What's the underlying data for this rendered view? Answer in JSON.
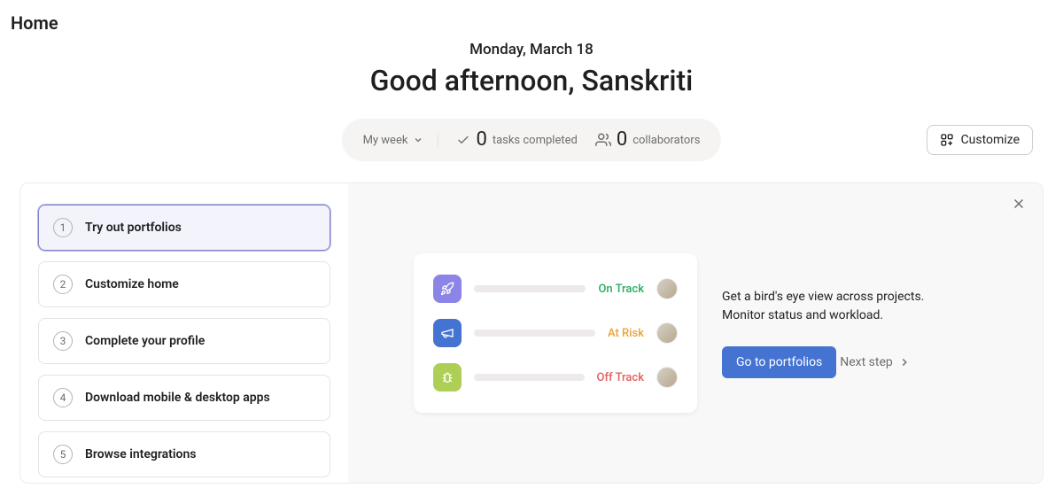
{
  "header": {
    "title": "Home"
  },
  "hero": {
    "date": "Monday, March 18",
    "greeting": "Good afternoon, Sanskriti"
  },
  "stats": {
    "my_week_label": "My week",
    "tasks_completed_count": "0",
    "tasks_completed_label": "tasks completed",
    "collaborators_count": "0",
    "collaborators_label": "collaborators"
  },
  "customize_button": "Customize",
  "onboarding": {
    "steps": [
      {
        "num": "1",
        "label": "Try out portfolios",
        "active": true
      },
      {
        "num": "2",
        "label": "Customize home",
        "active": false
      },
      {
        "num": "3",
        "label": "Complete your profile",
        "active": false
      },
      {
        "num": "4",
        "label": "Download mobile & desktop apps",
        "active": false
      },
      {
        "num": "5",
        "label": "Browse integrations",
        "active": false
      }
    ],
    "preview": {
      "rows": [
        {
          "icon": "rocket",
          "color": "purple",
          "status_label": "On Track",
          "status_class": "status-green"
        },
        {
          "icon": "megaphone",
          "color": "blue",
          "status_label": "At Risk",
          "status_class": "status-amber"
        },
        {
          "icon": "bug",
          "color": "green",
          "status_label": "Off Track",
          "status_class": "status-red"
        }
      ]
    },
    "description": "Get a bird's eye view across projects. Monitor status and workload.",
    "cta_button": "Go to portfolios",
    "next_step_label": "Next step"
  }
}
